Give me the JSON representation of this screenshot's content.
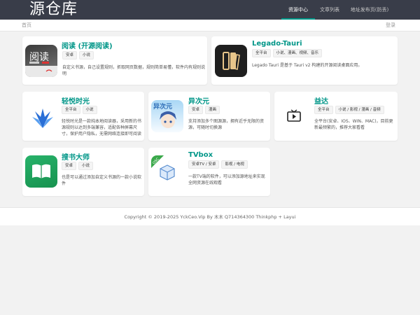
{
  "header": {
    "logo": "源仓库",
    "nav": [
      {
        "label": "资源中心",
        "active": true
      },
      {
        "label": "文章列表",
        "active": false
      },
      {
        "label": "地址发布页(防丢)",
        "active": false
      }
    ]
  },
  "breadcrumb": {
    "home": "首页",
    "login": "登录"
  },
  "cards": [
    {
      "title": "阅读 (开源阅读)",
      "tags": [
        "安卓",
        "小说"
      ],
      "desc": "自定义书源，自己设置规则，抓取网页数据，规则简单易懂，软件内有规则说明",
      "icon": "legado-reader-icon",
      "icon_text": "阅读"
    },
    {
      "title": "Legado-Tauri",
      "tags": [
        "全平台",
        "小说、漫画、视频、音乐"
      ],
      "desc": "Legado Tauri 是基于 Tauri v2 构建的开源阅读桌面应用。",
      "icon": "book-pages-icon"
    },
    {
      "title": "轻悦时光",
      "tags": [
        "全平台",
        "小说"
      ],
      "desc": "轻悦时光是一款纯本地阅读器，采用新的书源规则以达到多端兼容，适配各种屏幕尺寸，保护用户隐私，无需网络连接即可阅读",
      "icon": "wings-logo-icon"
    },
    {
      "title": "异次元",
      "tags": [
        "安卓",
        "漫画"
      ],
      "desc": "支持添加多个图源源，拥有近乎无限的资源，可随时切换源",
      "icon": "anime-girl-icon",
      "icon_text": "异次元"
    },
    {
      "title": "益达",
      "tags": [
        "全平台",
        "小说 / 影视 / 漫画 / 音频"
      ],
      "desc": "全平台(安卓、IOS、WIN、MAC)，目前更新最频繁的，推荐大家看看",
      "icon": "tv-play-icon"
    },
    {
      "title": "搜书大师",
      "tags": [
        "安卓",
        "小说"
      ],
      "desc": "也是可以通过添加自定义书源的一款小说软件",
      "icon": "open-book-icon"
    },
    {
      "title": "TVbox",
      "tags": [
        "安卓TV / 安卓",
        "影视 / 电视"
      ],
      "desc": "一款TV端的软件，可以添加源地址来实现全网资源在线观看",
      "icon": "box-cube-icon",
      "ribbon": "OSC"
    }
  ],
  "colors": {
    "header_bg": "#393d49",
    "accent": "#009688",
    "page_bg": "#f2f2f2"
  },
  "footer": {
    "text": "Copyright © 2019-2025 YckCeo.Vip    By 木木 Q714364300 Thinkphp + Layui"
  }
}
